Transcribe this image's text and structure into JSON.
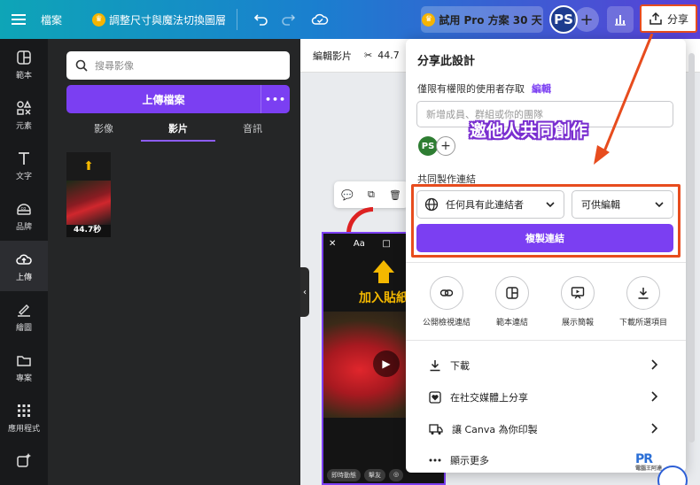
{
  "topbar": {
    "file_menu": "檔案",
    "resize_label": "調整尺寸與魔法切換圖層",
    "pro_label": "試用 Pro 方案 30 天",
    "avatar_initials": "PS",
    "share_label": "分享",
    "gradient_start": "#0ea5b7",
    "gradient_end": "#5a3fd6"
  },
  "rail": {
    "items": [
      {
        "label": "範本",
        "icon": "template-icon"
      },
      {
        "label": "元素",
        "icon": "elements-icon"
      },
      {
        "label": "文字",
        "icon": "text-icon"
      },
      {
        "label": "品牌",
        "icon": "brand-icon"
      },
      {
        "label": "上傳",
        "icon": "upload-cloud-icon",
        "active": true
      },
      {
        "label": "繪圖",
        "icon": "draw-icon"
      },
      {
        "label": "專案",
        "icon": "folder-icon"
      },
      {
        "label": "應用程式",
        "icon": "apps-icon"
      }
    ]
  },
  "panel": {
    "search_placeholder": "搜尋影像",
    "upload_button": "上傳檔案",
    "more_button": "•••",
    "tabs": [
      "影像",
      "影片",
      "音訊"
    ],
    "active_tab": "影片",
    "thumb_duration": "44.7秒"
  },
  "canvas": {
    "edit_video": "編輯影片",
    "duration": "44.7",
    "page_title": "加入貼紙",
    "page_tools": [
      "✕",
      "Aa",
      "□",
      "⊕",
      "◎"
    ],
    "foot_chips": [
      "即時動態",
      "擊友",
      "◎"
    ]
  },
  "share": {
    "title": "分享此設計",
    "access_label": "僅限有權限的使用者存取",
    "edit_link": "編輯",
    "add_people_placeholder": "新增成員、群組或你的團隊",
    "member_initials": "PS",
    "member_color": "#2e7d32",
    "collab_label": "共同製作連結",
    "access_select": "任何具有此連結者",
    "permission_select": "可供編輯",
    "copy_button": "複製連結",
    "options": [
      {
        "label": "公開檢視連結",
        "icon": "link-icon"
      },
      {
        "label": "範本連結",
        "icon": "template-link-icon"
      },
      {
        "label": "展示簡報",
        "icon": "present-icon"
      },
      {
        "label": "下載所選項目",
        "icon": "download-icon"
      }
    ],
    "rows": [
      {
        "label": "下載",
        "icon": "download-icon"
      },
      {
        "label": "在社交媒體上分享",
        "icon": "heart-icon"
      },
      {
        "label": "讓 Canva 為你印製",
        "icon": "truck-icon"
      },
      {
        "label": "顯示更多",
        "icon": "more-icon"
      }
    ],
    "accent": "#7b3ff2"
  },
  "annotation": {
    "text": "邀他人共同創作",
    "highlight_color": "#e74c1e"
  },
  "watermark": {
    "logo": "PR",
    "sub": "電腦王阿達"
  }
}
